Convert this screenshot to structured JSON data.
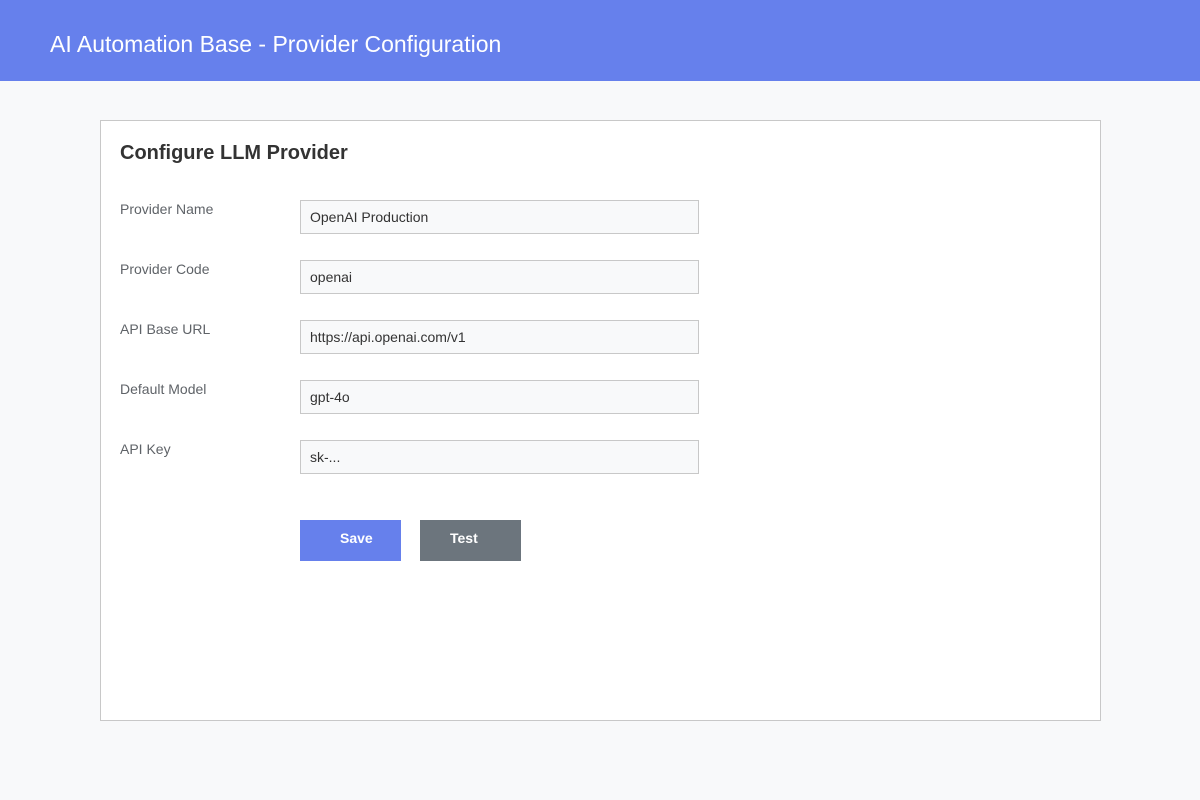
{
  "header": {
    "title": "AI Automation Base - Provider Configuration"
  },
  "form": {
    "title": "Configure LLM Provider",
    "fields": [
      {
        "label": "Provider Name",
        "value": "OpenAI Production"
      },
      {
        "label": "Provider Code",
        "value": "openai"
      },
      {
        "label": "API Base URL",
        "value": "https://api.openai.com/v1"
      },
      {
        "label": "Default Model",
        "value": "gpt-4o"
      },
      {
        "label": "API Key",
        "value": "sk-..."
      }
    ],
    "buttons": {
      "save_label": "Save",
      "test_label": "Test"
    }
  },
  "colors": {
    "accent": "#6680ec",
    "secondary_button": "#6c757d",
    "page_background": "#f8f9fa"
  }
}
